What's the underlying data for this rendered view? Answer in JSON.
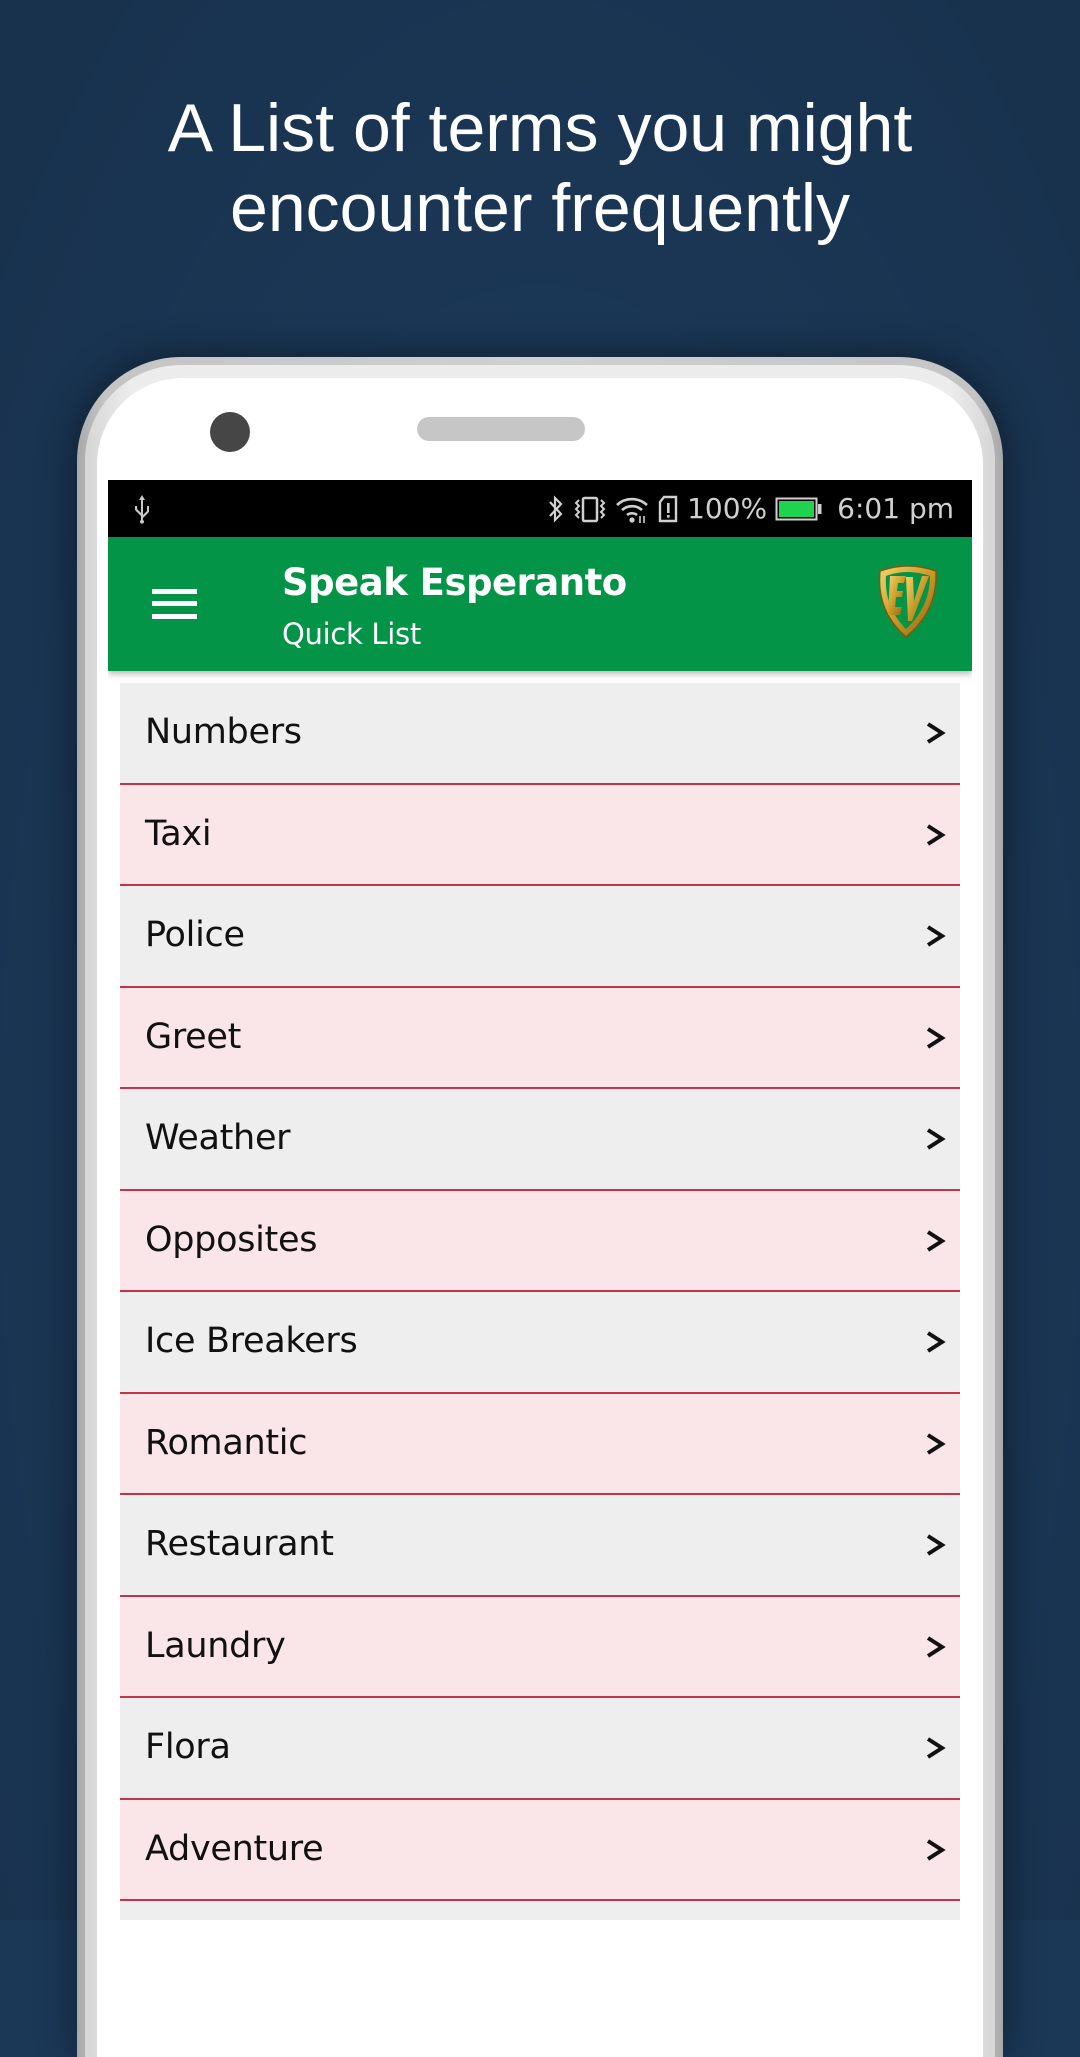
{
  "headline": {
    "line1": "A List of terms you might",
    "line2": "encounter frequently"
  },
  "status_bar": {
    "left_icon": "usb-icon",
    "icons": [
      "bluetooth-icon",
      "vibrate-icon",
      "wifi-icon",
      "sim-alert-icon"
    ],
    "battery_percent": "100%",
    "battery_level": 1.0,
    "battery_color": "#1ed44f",
    "time": "6:01 pm"
  },
  "app_bar": {
    "menu_icon": "hamburger-menu-icon",
    "title": "Speak Esperanto",
    "subtitle": "Quick List",
    "logo_icon": "ev-shield-logo-icon",
    "color": "#039447"
  },
  "list": {
    "chevron_icon": "chevron-right-icon",
    "separator_color": "#c2344a",
    "row_colors": [
      "#eeeeee",
      "#fae6e9"
    ],
    "items": [
      {
        "label": "Numbers"
      },
      {
        "label": "Taxi"
      },
      {
        "label": "Police"
      },
      {
        "label": "Greet"
      },
      {
        "label": "Weather"
      },
      {
        "label": "Opposites"
      },
      {
        "label": "Ice Breakers"
      },
      {
        "label": "Romantic"
      },
      {
        "label": "Restaurant"
      },
      {
        "label": "Laundry"
      },
      {
        "label": "Flora"
      },
      {
        "label": "Adventure"
      },
      {
        "label": ""
      }
    ]
  }
}
